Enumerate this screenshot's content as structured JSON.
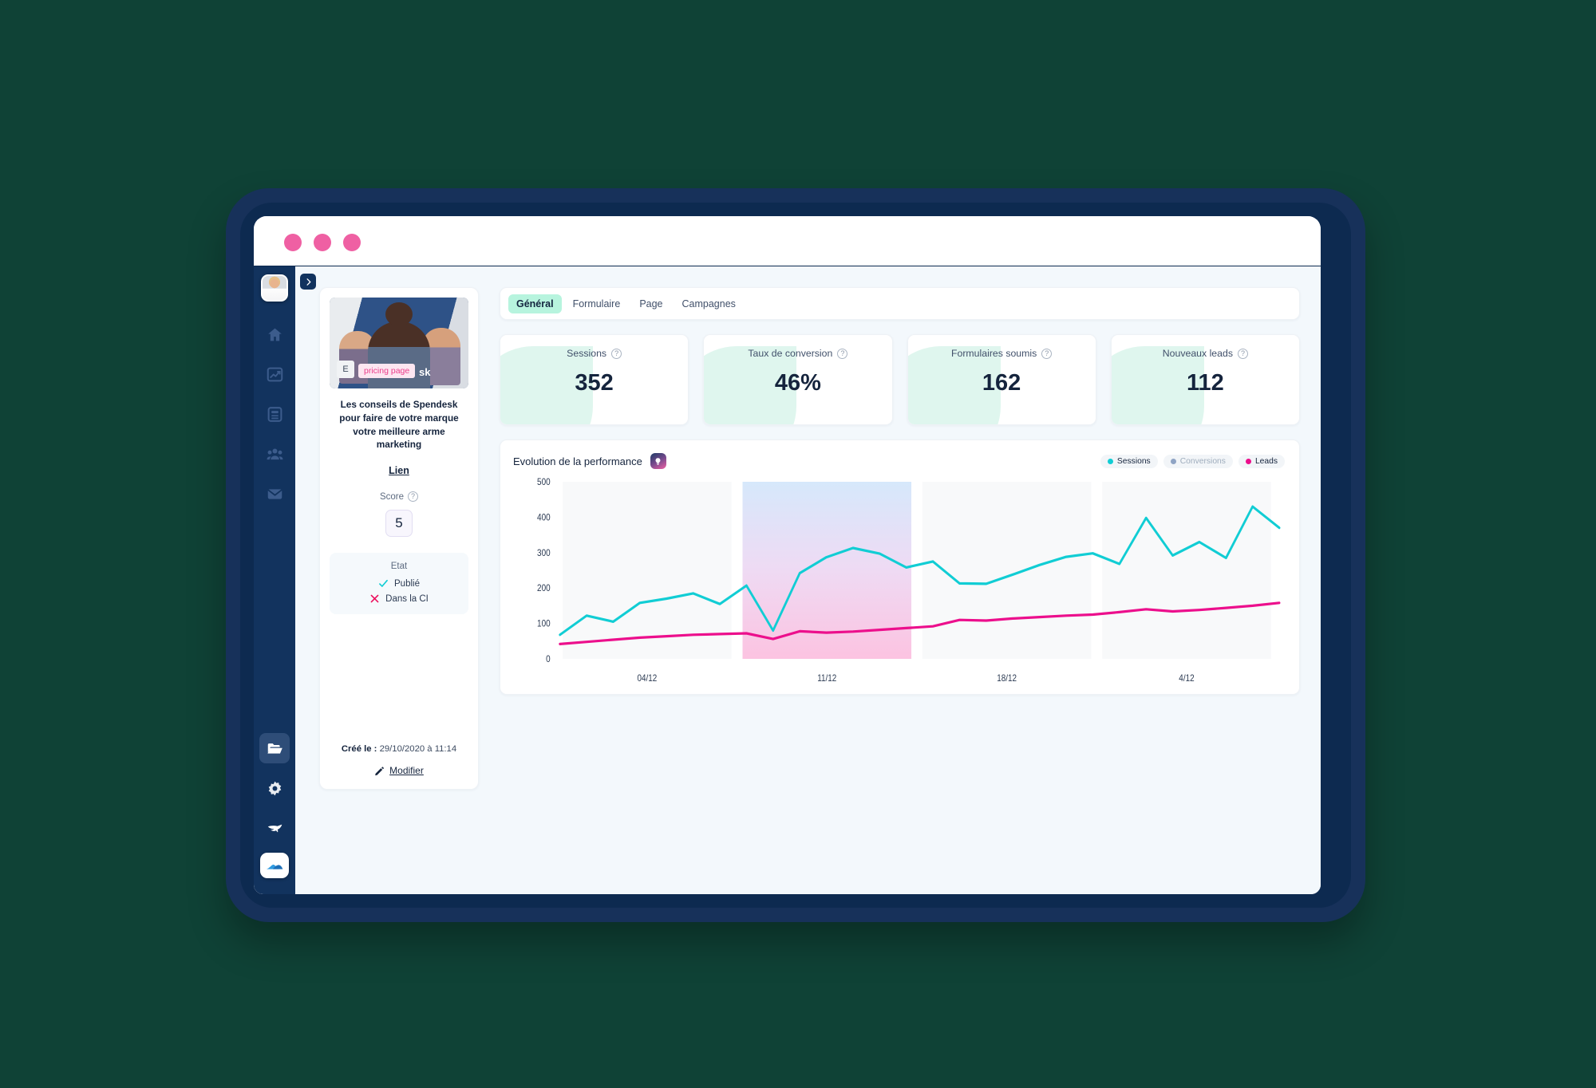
{
  "window": {
    "dots": [
      "close",
      "minimize",
      "maximize"
    ]
  },
  "sidebar": {
    "avatar_name": "user-avatar",
    "items": [
      {
        "name": "home",
        "label": "Accueil"
      },
      {
        "name": "analytics",
        "label": "Analytics"
      },
      {
        "name": "content",
        "label": "Contenu"
      },
      {
        "name": "audience",
        "label": "Audience"
      },
      {
        "name": "mail",
        "label": "Emails"
      }
    ],
    "bottom_items": [
      {
        "name": "folder",
        "label": "Dossiers",
        "active": true
      },
      {
        "name": "settings",
        "label": "Paramètres",
        "active": false
      },
      {
        "name": "plezi",
        "label": "Plezi",
        "active": false
      },
      {
        "name": "logo",
        "label": "Logo",
        "active": false
      }
    ],
    "collapse_label": "›"
  },
  "left_card": {
    "thumbnail": {
      "badge_letter": "E",
      "tag_label": "pricing page",
      "brand_text": "sk"
    },
    "title": "Les conseils de Spendesk pour faire de votre marque votre meilleure arme marketing",
    "link_label": "Lien",
    "score_label": "Score",
    "score_value": "5",
    "etat_label": "Etat",
    "etat_rows": [
      {
        "label": "Publié",
        "state": "check"
      },
      {
        "label": "Dans la CI",
        "state": "cross"
      }
    ],
    "created_label": "Créé le :",
    "created_value": "29/10/2020 à 11:14",
    "edit_label": "Modifier"
  },
  "tabs": [
    {
      "label": "Général",
      "active": true
    },
    {
      "label": "Formulaire",
      "active": false
    },
    {
      "label": "Page",
      "active": false
    },
    {
      "label": "Campagnes",
      "active": false
    }
  ],
  "kpis": [
    {
      "label": "Sessions",
      "value": "352"
    },
    {
      "label": "Taux de conversion",
      "value": "46%"
    },
    {
      "label": "Formulaires soumis",
      "value": "162"
    },
    {
      "label": "Nouveaux leads",
      "value": "112"
    }
  ],
  "chart_card": {
    "title": "Evolution de la performance",
    "icon": "lightbulb-icon",
    "legend": [
      {
        "label": "Sessions",
        "color": "#11cdd4",
        "active": true
      },
      {
        "label": "Conversions",
        "color": "#8fa4c4",
        "active": false
      },
      {
        "label": "Leads",
        "color": "#ec0f8c",
        "active": true
      }
    ]
  },
  "chart_data": {
    "type": "line",
    "title": "Evolution de la performance",
    "xlabel": "",
    "ylabel": "",
    "ylim": [
      0,
      500
    ],
    "yticks": [
      0,
      100,
      200,
      300,
      400,
      500
    ],
    "grid": false,
    "legend_position": "top-right",
    "categories": [
      "04/12",
      "11/12",
      "18/12",
      "4/12"
    ],
    "band_highlight_index": 1,
    "band_colors": {
      "normal": "#f8f9fa",
      "highlight_top": "#d6e8fb",
      "highlight_bottom": "#fcc9e4"
    },
    "x": [
      0,
      1,
      2,
      3,
      4,
      5,
      6,
      7,
      8,
      9,
      10,
      11,
      12,
      13,
      14,
      15,
      16,
      17,
      18,
      19,
      20,
      21,
      22,
      23,
      24,
      25,
      26,
      27
    ],
    "series": [
      {
        "name": "Sessions",
        "color": "#11cdd4",
        "values": [
          68,
          122,
          105,
          158,
          170,
          185,
          155,
          207,
          80,
          242,
          287,
          313,
          297,
          258,
          275,
          213,
          212,
          238,
          265,
          288,
          298,
          268,
          398,
          292,
          330,
          285,
          430,
          370
        ]
      },
      {
        "name": "Leads",
        "color": "#ec0f8c",
        "values": [
          42,
          48,
          54,
          60,
          64,
          68,
          70,
          72,
          56,
          78,
          74,
          77,
          82,
          87,
          92,
          110,
          108,
          114,
          118,
          122,
          125,
          132,
          140,
          134,
          138,
          144,
          150,
          158
        ]
      }
    ]
  }
}
